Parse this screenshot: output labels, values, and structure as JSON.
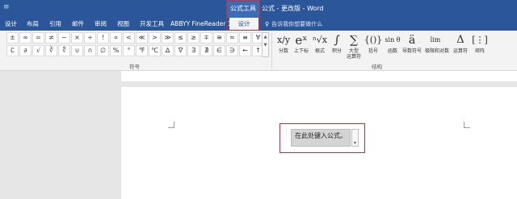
{
  "titlebar": {
    "qat_icon": "save-icon",
    "context_tab_title": "公式工具",
    "document_title": "公式 - 更改版  -  Word"
  },
  "tabs": [
    {
      "label": "设计"
    },
    {
      "label": "布局"
    },
    {
      "label": "引用"
    },
    {
      "label": "邮件"
    },
    {
      "label": "审阅"
    },
    {
      "label": "视图"
    },
    {
      "label": "开发工具"
    },
    {
      "label": "ABBYY FineReader 12"
    },
    {
      "label": "设计"
    }
  ],
  "tellme": {
    "placeholder": "告诉我你想要做什么"
  },
  "symbols": {
    "row1": [
      "±",
      "∞",
      "=",
      "≠",
      "~",
      "×",
      "÷",
      "!",
      "∝",
      "<",
      "≪",
      ">",
      "≫",
      "≤",
      "≥",
      "∓",
      "≅",
      "≈",
      "≡",
      "∀"
    ],
    "row2": [
      "∁",
      "∂",
      "√",
      "∛",
      "∜",
      "∪",
      "∩",
      "∅",
      "%",
      "°",
      "℉",
      "℃",
      "∆",
      "∇",
      "∃",
      "∄",
      "∈",
      "∋",
      "←",
      "↑"
    ],
    "group_label": "符号"
  },
  "structures": {
    "group_label": "结构",
    "items": [
      {
        "glyph": "x/y",
        "label": "分数"
      },
      {
        "glyph": "eˣ",
        "label": "上下标"
      },
      {
        "glyph": "ⁿ√x",
        "label": "根式"
      },
      {
        "glyph": "∫",
        "label": "积分"
      },
      {
        "glyph": "∑",
        "label": "大型\n运算符"
      },
      {
        "glyph": "{()}",
        "label": "括号"
      },
      {
        "glyph": "sin θ",
        "label": "函数"
      },
      {
        "glyph": "ä",
        "label": "导数符号"
      },
      {
        "glyph": "lim",
        "label": "极限和对数"
      },
      {
        "glyph": "Δ",
        "label": "运算符"
      },
      {
        "glyph": "[⋮]",
        "label": "矩阵"
      }
    ]
  },
  "equation": {
    "placeholder": "在此处键入公式。"
  }
}
